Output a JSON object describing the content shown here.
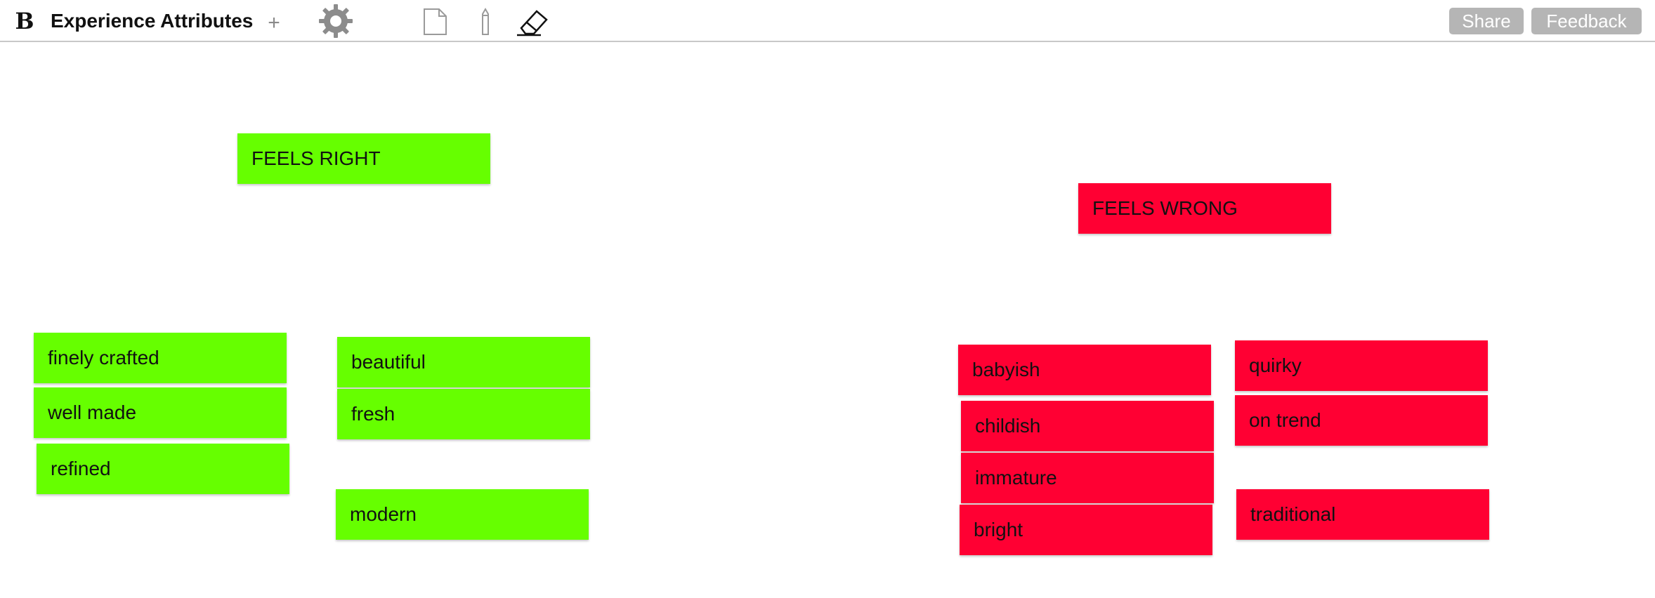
{
  "app": {
    "logo": "B",
    "board_title": "Experience Attributes",
    "add_symbol": "+"
  },
  "toolbar": {
    "icons": [
      "logo-icon",
      "gear-icon",
      "note-icon",
      "pencil-icon",
      "eraser-icon"
    ],
    "share_label": "Share",
    "feedback_label": "Feedback"
  },
  "colors": {
    "feels_right": "#66ff00",
    "feels_wrong": "#ff0033",
    "button_gray": "#b5b5b5"
  },
  "notes": {
    "feels_right_header": "FEELS RIGHT",
    "feels_wrong_header": "FEELS WRONG",
    "finely_crafted": "finely crafted",
    "well_made": "well made",
    "refined": "refined",
    "beautiful": "beautiful",
    "fresh": "fresh",
    "modern": "modern",
    "babyish": "babyish",
    "childish": "childish",
    "immature": "immature",
    "bright": "bright",
    "quirky": "quirky",
    "on_trend": "on trend",
    "traditional": "traditional"
  }
}
